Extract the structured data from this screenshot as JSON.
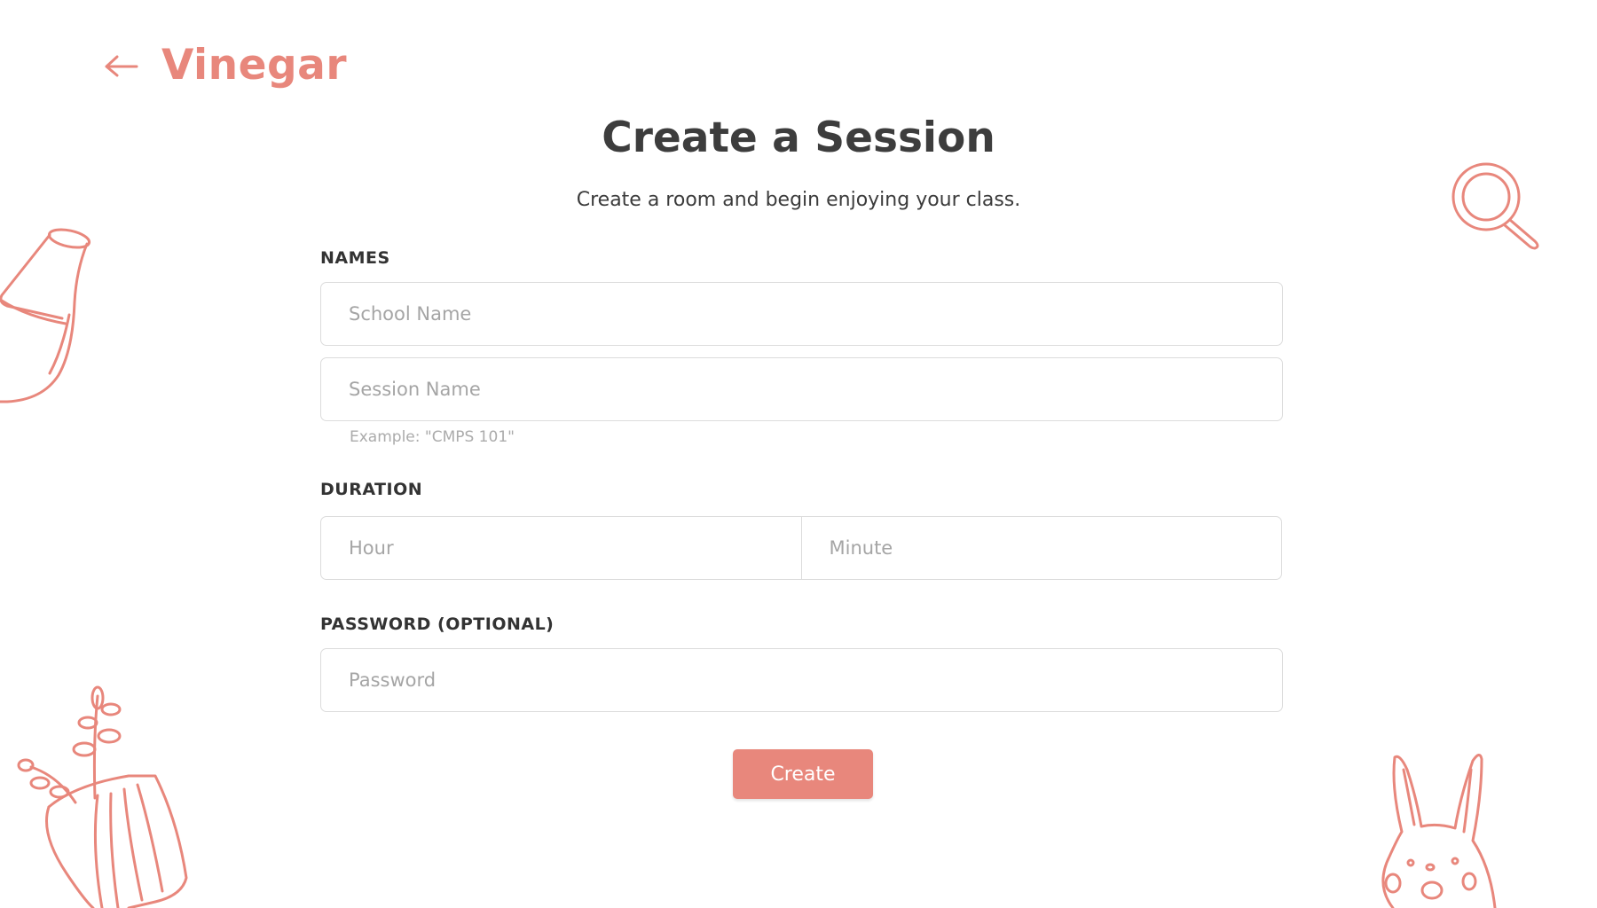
{
  "colors": {
    "accent": "#e8877c",
    "text_dark": "#3b3b3b",
    "placeholder": "#a5a5a5",
    "border": "#dcdcdc"
  },
  "header": {
    "back_icon": "arrow-left-icon",
    "brand": "Vinegar"
  },
  "page": {
    "title": "Create a Session",
    "subtitle": "Create a room and begin enjoying your class."
  },
  "form": {
    "names": {
      "label": "NAMES",
      "school_placeholder": "School Name",
      "session_placeholder": "Session Name",
      "session_hint": "Example: \"CMPS 101\""
    },
    "duration": {
      "label": "DURATION",
      "hour_placeholder": "Hour",
      "minute_placeholder": "Minute"
    },
    "password": {
      "label": "PASSWORD (OPTIONAL)",
      "placeholder": "Password"
    },
    "submit_label": "Create"
  },
  "decorations": [
    "vase-doodle-icon",
    "magnifier-doodle-icon",
    "potted-plant-doodle-icon",
    "bunny-doodle-icon"
  ]
}
